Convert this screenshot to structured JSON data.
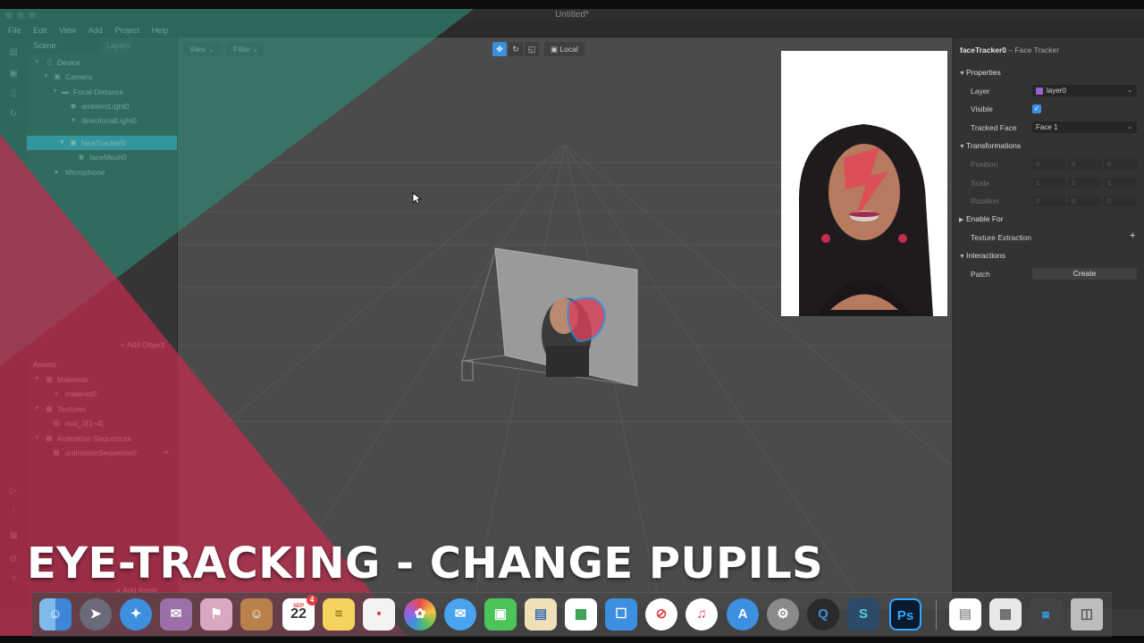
{
  "window": {
    "title": "Untitled*"
  },
  "menu": [
    "File",
    "Edit",
    "View",
    "Add",
    "Project",
    "Help"
  ],
  "left_panel": {
    "tabs": [
      "Scene",
      "Layers"
    ],
    "scene_tree": [
      {
        "label": "Device",
        "icon": "device-icon",
        "selected": false
      },
      {
        "label": "Camera",
        "icon": "camera-icon",
        "selected": false
      },
      {
        "label": "Focal Distance",
        "icon": "focal-distance-icon",
        "selected": false
      },
      {
        "label": "ambientLight0",
        "icon": "ambient-light-icon",
        "selected": false
      },
      {
        "label": "directionalLight0",
        "icon": "directional-light-icon",
        "selected": false
      },
      {
        "label": "faceTracker0",
        "icon": "face-tracker-icon",
        "selected": true
      },
      {
        "label": "faceMesh0",
        "icon": "face-mesh-icon",
        "selected": false
      },
      {
        "label": "Microphone",
        "icon": "microphone-icon",
        "selected": false
      }
    ],
    "add_object": "Add Object",
    "assets_title": "Assets",
    "assets_tree": [
      {
        "label": "Materials",
        "icon": "folder-icon"
      },
      {
        "label": "material0",
        "icon": "material-sphere-icon"
      },
      {
        "label": "Textures",
        "icon": "folder-icon"
      },
      {
        "label": "mat_0[1–4]",
        "icon": "texture-icon"
      },
      {
        "label": "Animation Sequences",
        "icon": "folder-icon"
      },
      {
        "label": "animationSequence0",
        "icon": "animation-sequence-icon"
      }
    ],
    "add_asset": "Add Asset"
  },
  "viewport": {
    "view_button": "View",
    "filter_button": "Filter",
    "local_button": "Local"
  },
  "inspector": {
    "title": "faceTracker0",
    "subtitle": "– Face Tracker",
    "sections": {
      "properties": "Properties",
      "transformations": "Transformations",
      "enable_for": "Enable For",
      "texture_extraction": "Texture Extraction",
      "interactions": "Interactions"
    },
    "layer_label": "Layer",
    "layer_value": "layer0",
    "visible_label": "Visible",
    "visible_checked": true,
    "tracked_face_label": "Tracked Face",
    "tracked_face_value": "Face 1",
    "position_label": "Position",
    "scale_label": "Scale",
    "rotation_label": "Rotation",
    "position_values": [
      "0",
      "0",
      "0"
    ],
    "scale_values": [
      "1",
      "1",
      "1"
    ],
    "rotation_values": [
      "0",
      "0",
      "0"
    ],
    "patch_label": "Patch",
    "create_button": "Create"
  },
  "overlay": {
    "headline": "EYE-TRACKING - CHANGE PUPILS",
    "teal_color": "#2e8a78",
    "red_color": "#c42d4e"
  },
  "dock": {
    "calendar_month": "SEP",
    "calendar_day": "22",
    "calendar_badge": "4",
    "photoshop_label": "Ps"
  },
  "colors": {
    "selection": "#3ca6dd",
    "accent": "#3b8fdc",
    "layer_swatch": "#9a5fd0"
  }
}
